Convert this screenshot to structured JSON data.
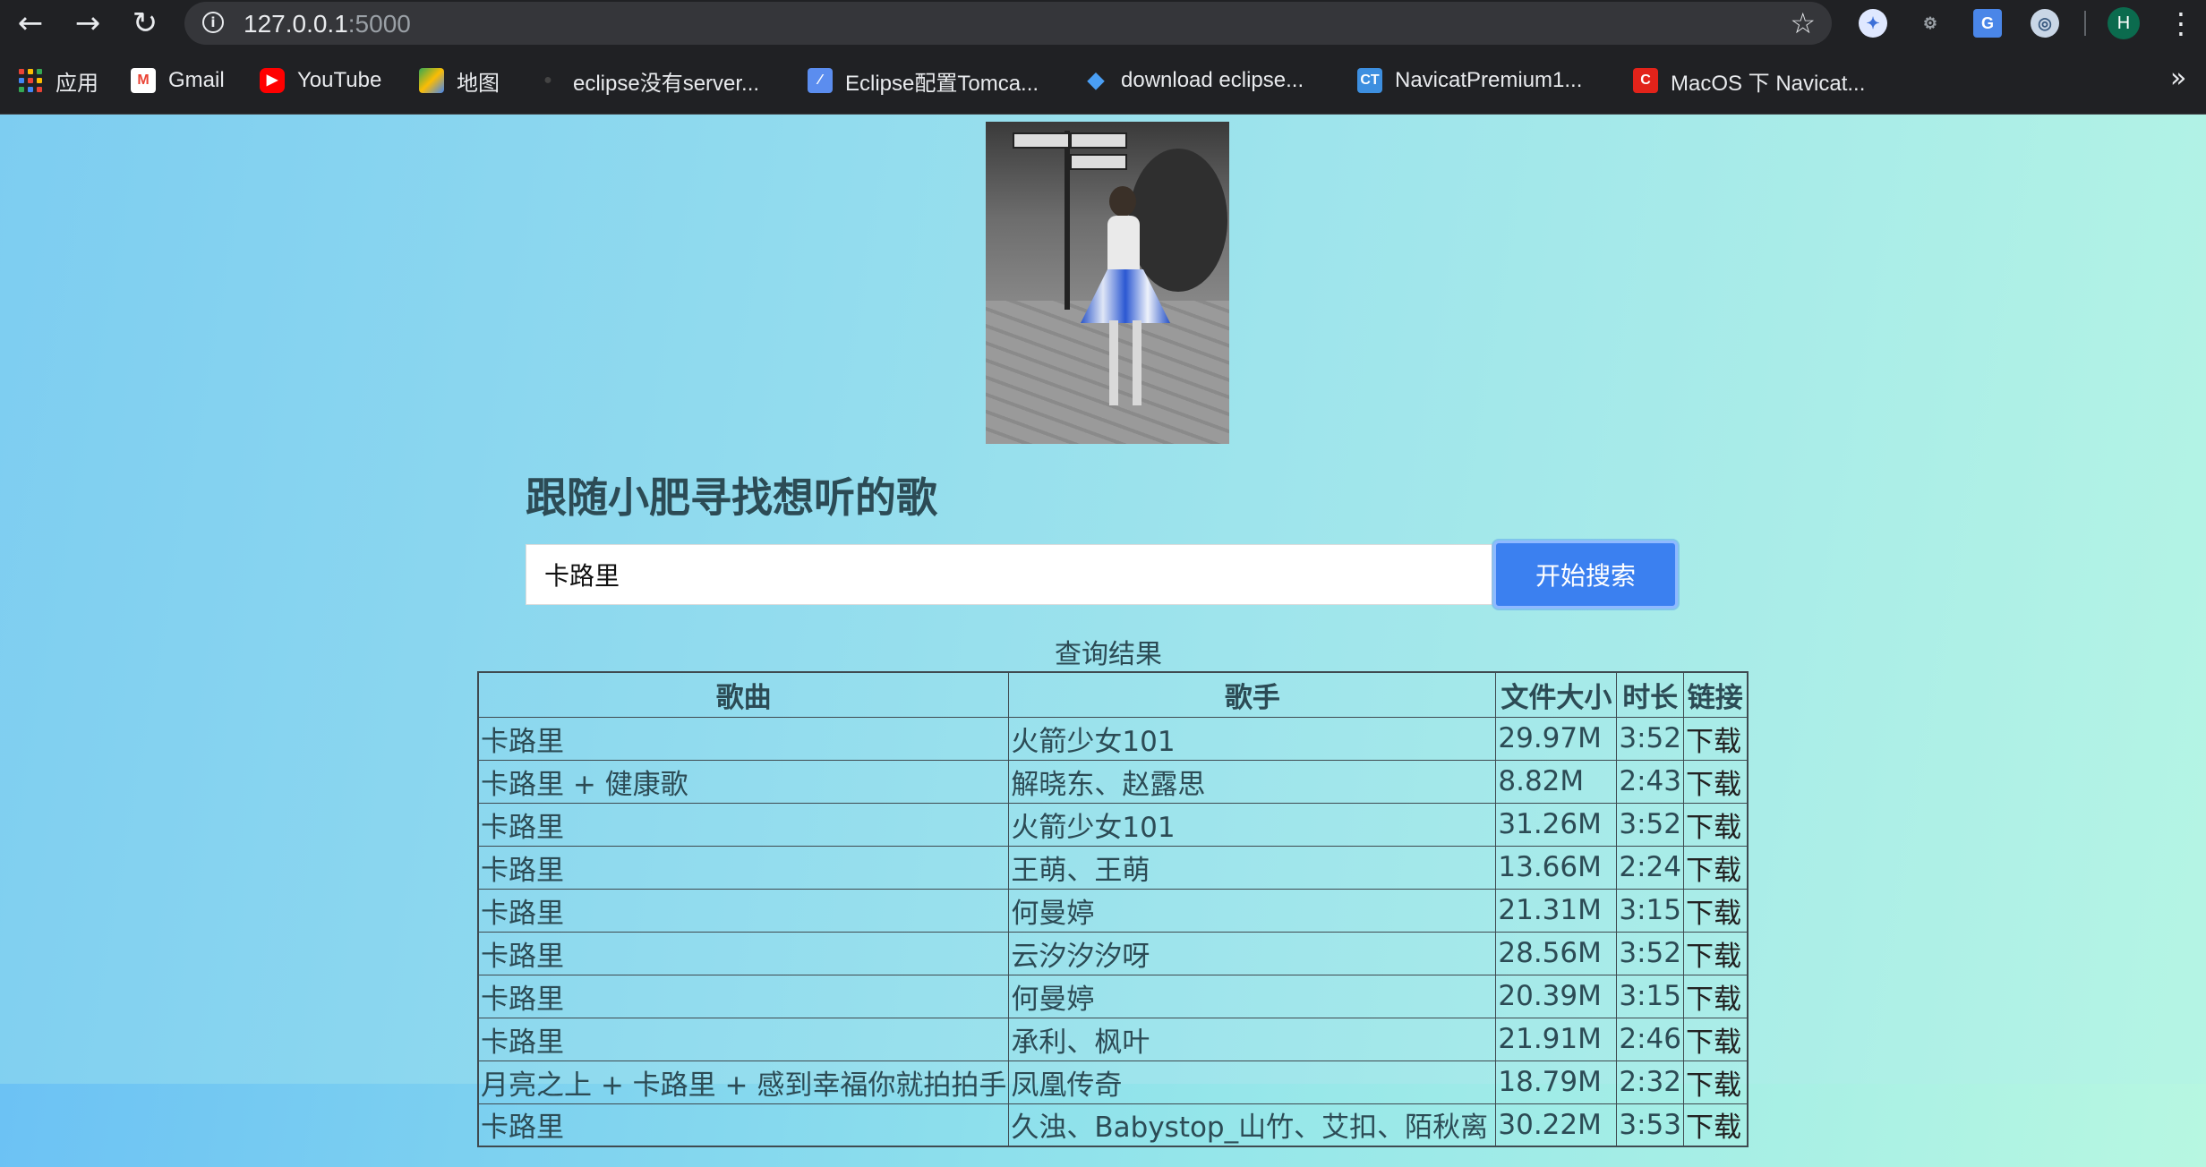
{
  "browser": {
    "url_host": "127.0.0.1",
    "url_port": ":5000",
    "profile_initial": "H",
    "bookmarks": [
      {
        "label": "应用",
        "icon": "apps-grid-icon"
      },
      {
        "label": "Gmail",
        "icon": "gmail-icon"
      },
      {
        "label": "YouTube",
        "icon": "youtube-icon"
      },
      {
        "label": "地图",
        "icon": "maps-icon"
      },
      {
        "label": "eclipse没有server...",
        "icon": "github-icon"
      },
      {
        "label": "Eclipse配置Tomca...",
        "icon": "feather-icon"
      },
      {
        "label": "download eclipse...",
        "icon": "download-icon"
      },
      {
        "label": "NavicatPremium1...",
        "icon": "ct-icon"
      },
      {
        "label": "MacOS 下 Navicat...",
        "icon": "csdn-icon"
      }
    ]
  },
  "page": {
    "heading": "跟随小肥寻找想听的歌",
    "search": {
      "value": "卡路里",
      "button_label": "开始搜索"
    },
    "results": {
      "caption": "查询结果",
      "columns": [
        "歌曲",
        "歌手",
        "文件大小",
        "时长",
        "链接"
      ],
      "rows": [
        {
          "song": "卡路里",
          "singer": "火箭少女101",
          "size": "29.97M",
          "duration": "3:52",
          "link": "下载"
        },
        {
          "song": "卡路里 + 健康歌",
          "singer": "解晓东、赵露思",
          "size": "8.82M",
          "duration": "2:43",
          "link": "下载"
        },
        {
          "song": "卡路里",
          "singer": "火箭少女101",
          "size": "31.26M",
          "duration": "3:52",
          "link": "下载"
        },
        {
          "song": "卡路里",
          "singer": "王萌、王萌",
          "size": "13.66M",
          "duration": "2:24",
          "link": "下载"
        },
        {
          "song": "卡路里",
          "singer": "何曼婷",
          "size": "21.31M",
          "duration": "3:15",
          "link": "下载"
        },
        {
          "song": "卡路里",
          "singer": "云汐汐汐呀",
          "size": "28.56M",
          "duration": "3:52",
          "link": "下载"
        },
        {
          "song": "卡路里",
          "singer": "何曼婷",
          "size": "20.39M",
          "duration": "3:15",
          "link": "下载"
        },
        {
          "song": "卡路里",
          "singer": "承利、枫叶",
          "size": "21.91M",
          "duration": "2:46",
          "link": "下载"
        },
        {
          "song": "月亮之上 + 卡路里 + 感到幸福你就拍拍手",
          "singer": "凤凰传奇",
          "size": "18.79M",
          "duration": "2:32",
          "link": "下载"
        },
        {
          "song": "卡路里",
          "singer": "久浊、Babystop_山竹、艾扣、陌秋离",
          "size": "30.22M",
          "duration": "3:53",
          "link": "下载"
        }
      ]
    }
  }
}
